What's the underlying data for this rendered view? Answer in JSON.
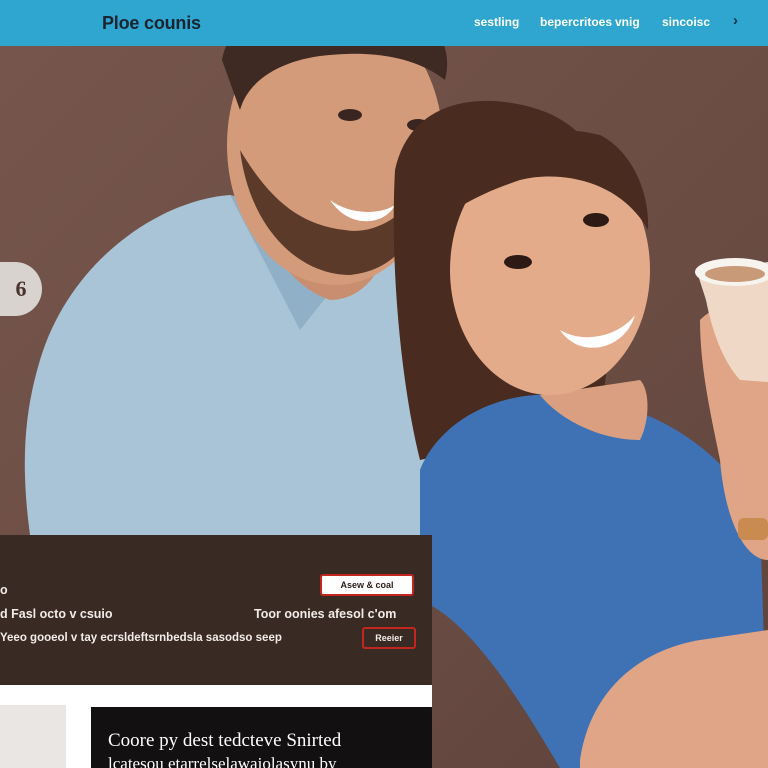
{
  "header": {
    "brand": "Ploe counis",
    "nav": [
      "sestling",
      "bepercritoes",
      "vnig",
      "sincoisc"
    ],
    "arrow_glyph": "›"
  },
  "hero": {
    "photo_alt": "smiling couple holding a coffee cup",
    "side_button_glyph": "6"
  },
  "panel": {
    "lines": [
      "o",
      "d Fasl octo v csuio",
      "Toor oonies afesol c'om",
      "Yeeo gooeol v tay ecrsldeftsrnbedsla sasodso seep"
    ],
    "top_button": "Asew & coal",
    "bottom_button": "Reeier"
  },
  "cards": {
    "title": "Coore py dest tedcteve Snirted",
    "subtitle": "lcatesou etarrelselawaiolasynu by"
  },
  "colors": {
    "nav_bg": "#2ea6cf",
    "hero_bg": "#6a4c43",
    "panel_bg": "#3a2a24",
    "button_border": "#c3251f",
    "card_dark": "#121010"
  }
}
